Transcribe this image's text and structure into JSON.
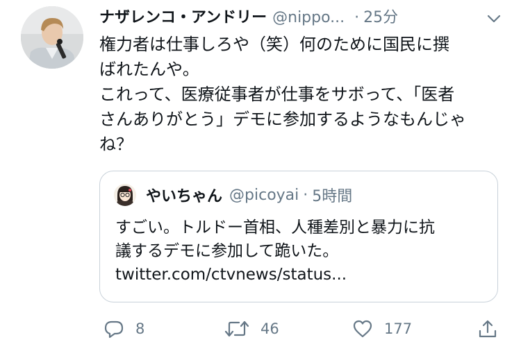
{
  "tweet": {
    "display_name": "ナザレンコ・アンドリー",
    "handle": "@nippo...",
    "separator": "·",
    "time": "25分",
    "text_lines": [
      "権力者は仕事しろや（笑）何のために国民に撰",
      "ばれたんや。",
      "これって、医療従事者が仕事をサボって、「医者",
      "さんありがとう」デモに参加するようなもんじゃ",
      "ね？"
    ]
  },
  "quoted_tweet": {
    "display_name": "やいちゃん",
    "handle": "@picoyai",
    "separator": "·",
    "time": "5時間",
    "text_lines": [
      "すごい。トルドー首相、人種差別と暴力に抗",
      "議するデモに参加して跪いた。"
    ],
    "link": "twitter.com/ctvnews/status..."
  },
  "actions": {
    "reply_count": "8",
    "retweet_count": "46",
    "like_count": "177"
  },
  "icons": {
    "more": "chevron-down-icon",
    "reply": "reply-icon",
    "retweet": "retweet-icon",
    "like": "heart-icon",
    "share": "share-icon"
  },
  "colors": {
    "text": "#0f1419",
    "secondary": "#657786",
    "border": "#c8d1d9"
  }
}
